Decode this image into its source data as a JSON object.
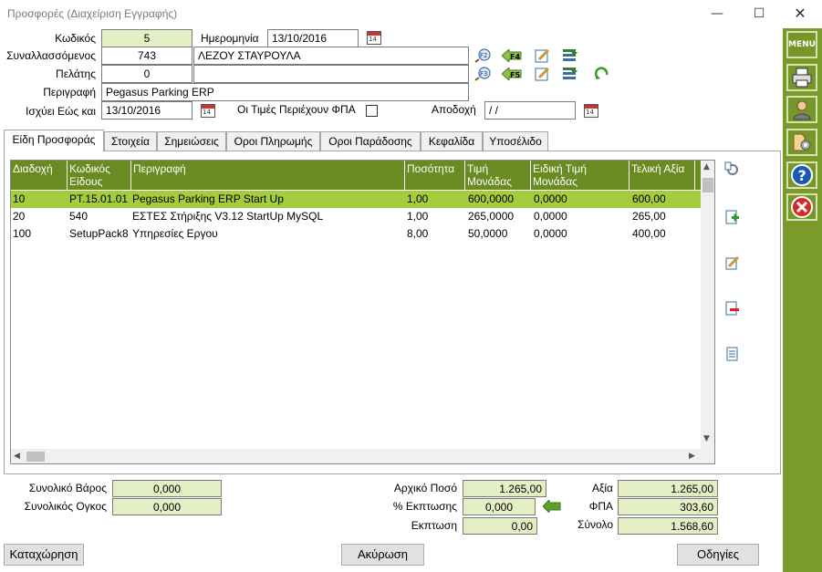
{
  "window": {
    "title": "Προσφορές (Διαχείριση Εγγραφής)"
  },
  "header": {
    "code_label": "Κωδικός",
    "code_value": "5",
    "date_label": "Ημερομηνία",
    "date_value": "13/10/2016",
    "trader_label": "Συναλλασσόμενος",
    "trader_code": "743",
    "trader_name": "ΛΕΖΟΥ ΣΤΑΥΡΟΥΛΑ",
    "customer_label": "Πελάτης",
    "customer_code": "0",
    "customer_name": "",
    "desc_label": "Περιγραφή",
    "desc_value": "Pegasus Parking ERP",
    "valid_label": "Ισχύει Εώς και",
    "valid_value": "13/10/2016",
    "vat_incl_label": "Οι Τιμές Περιέχουν ΦΠΑ",
    "accept_label": "Αποδοχή",
    "accept_value": "  /  /",
    "f2": "F2",
    "f3": "F3",
    "f4": "F4",
    "f5": "F5",
    "cal": "14"
  },
  "tabs": [
    "Είδη Προσφοράς",
    "Στοιχεία",
    "Σημειώσεις",
    "Οροι Πληρωμής",
    "Οροι Παράδοσης",
    "Κεφαλίδα",
    "Υποσέλιδο"
  ],
  "grid": {
    "columns": [
      "Διαδοχή",
      "Κωδικός Είδους",
      "Περιγραφή",
      "Ποσότητα",
      "Τιμή Μονάδας",
      "Ειδική Τιμή Μονάδας",
      "Τελική Αξία"
    ],
    "rows": [
      [
        "10",
        "PT.15.01.01",
        "Pegasus Parking ERP Start Up",
        "1,00",
        "600,0000",
        "0,0000",
        "600,00"
      ],
      [
        "20",
        "540",
        "ΕΣΤΕΣ Στήριξης V3.12 StartUp MySQL",
        "1,00",
        "265,0000",
        "0,0000",
        "265,00"
      ],
      [
        "100",
        "SetupPack8",
        "Υπηρεσίες Εργου",
        "8,00",
        "50,0000",
        "0,0000",
        "400,00"
      ]
    ]
  },
  "totals": {
    "weight_label": "Συνολικό Βάρος",
    "weight_value": "0,000",
    "volume_label": "Συνολικός Ογκος",
    "volume_value": "0,000",
    "initial_label": "Αρχικό Ποσό",
    "initial_value": "1.265,00",
    "discount_pct_label": "% Εκπτωσης",
    "discount_pct_value": "0,000",
    "discount_label": "Εκπτωση",
    "discount_value": "0,00",
    "value_label": "Αξία",
    "value_value": "1.265,00",
    "vat_label": "ΦΠΑ",
    "vat_value": "303,60",
    "total_label": "Σύνολο",
    "total_value": "1.568,60"
  },
  "buttons": {
    "save": "Καταχώρηση",
    "cancel": "Ακύρωση",
    "help": "Οδηγίες",
    "menu": "MENU"
  }
}
